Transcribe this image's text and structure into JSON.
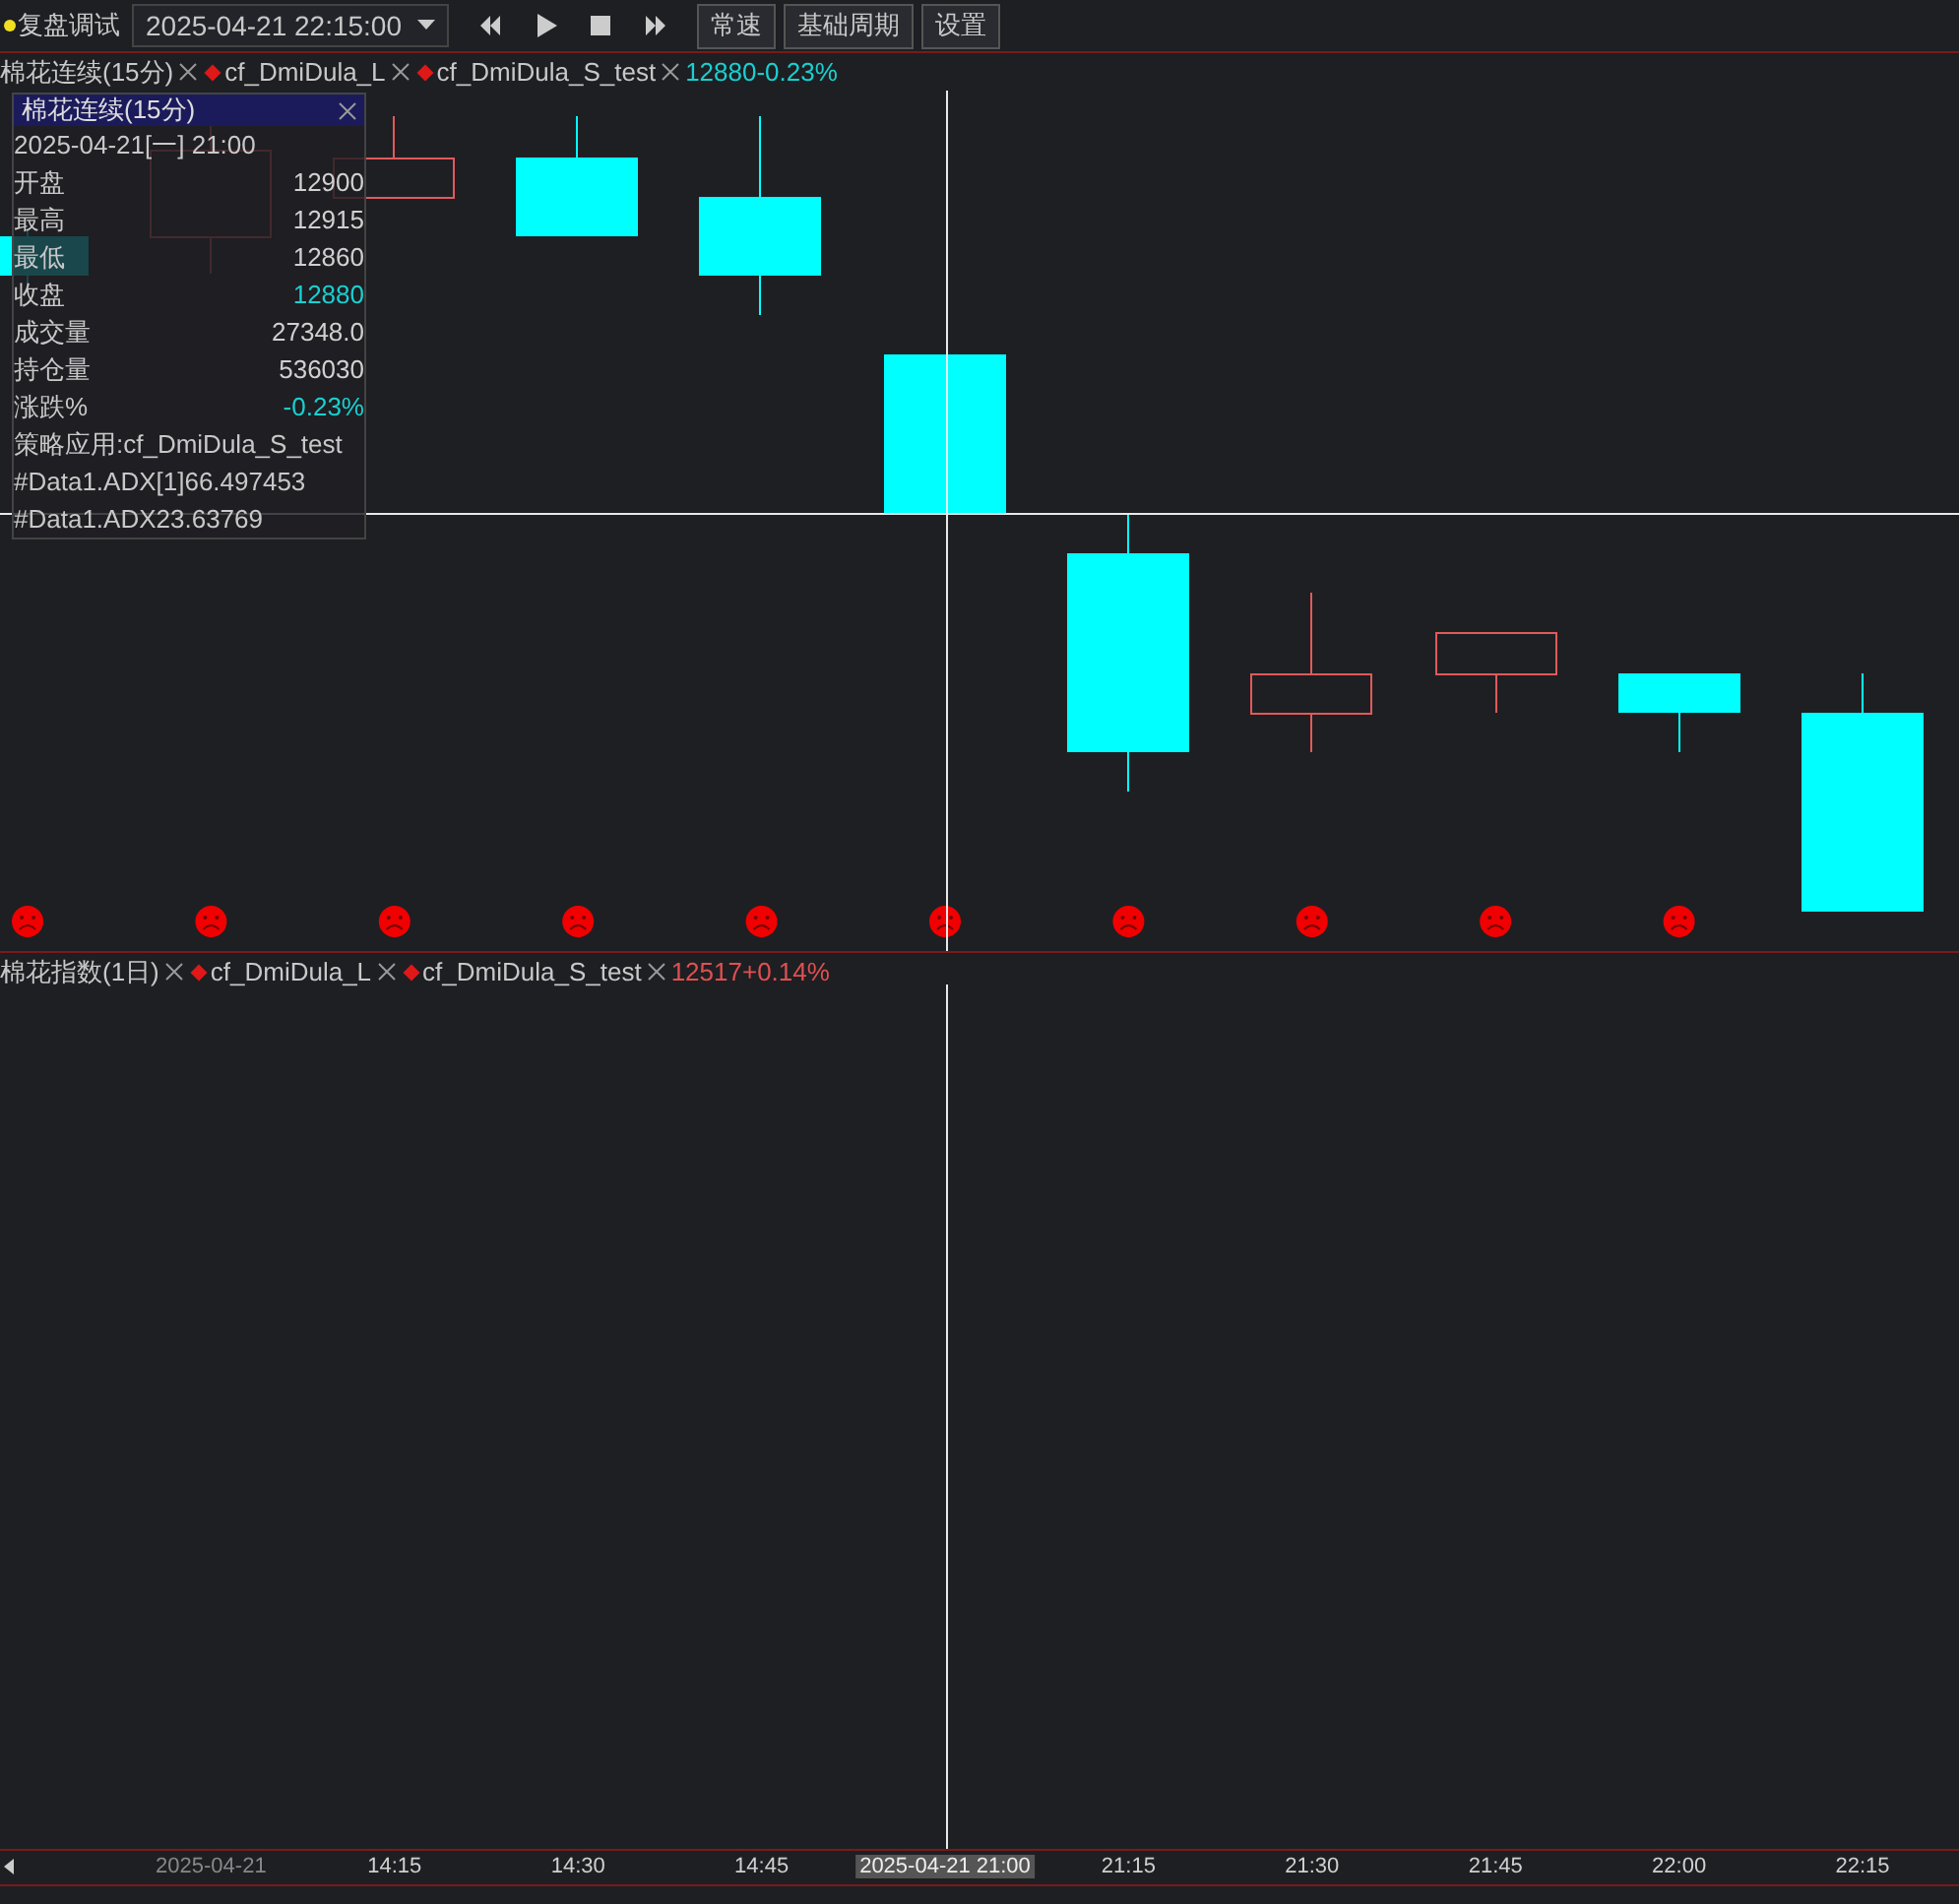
{
  "toolbar": {
    "title": "复盘调试",
    "datetime": "2025-04-21 22:15:00",
    "buttons": [
      "常速",
      "基础周期",
      "设置"
    ]
  },
  "panes": [
    {
      "symbol": "棉花连续(15分)",
      "strategies": [
        "cf_DmiDula_L",
        "cf_DmiDula_S_test"
      ],
      "quote": "12880-0.23%",
      "color": "#19d0d0"
    },
    {
      "symbol": "棉花指数(1日)",
      "strategies": [
        "cf_DmiDula_L",
        "cf_DmiDula_S_test"
      ],
      "quote": "12517+0.14%",
      "color": "#e05050"
    }
  ],
  "tooltip": {
    "title": "棉花连续(15分)",
    "date": "2025-04-21[一] 21:00",
    "rows": [
      {
        "label": "开盘",
        "value": "12900",
        "color": "#d0d0d0"
      },
      {
        "label": "最高",
        "value": "12915",
        "color": "#d0d0d0"
      },
      {
        "label": "最低",
        "value": "12860",
        "color": "#d0d0d0"
      },
      {
        "label": "收盘",
        "value": "12880",
        "color": "#19d0d0"
      },
      {
        "label": "成交量",
        "value": "27348.0",
        "color": "#d0d0d0"
      },
      {
        "label": "持仓量",
        "value": "536030",
        "color": "#d0d0d0"
      },
      {
        "label": "涨跌%",
        "value": "-0.23%",
        "color": "#19d0d0"
      }
    ],
    "lines": [
      "策略应用:cf_DmiDula_S_test",
      "#Data1.ADX[1]66.497453",
      "#Data1.ADX23.63769"
    ]
  },
  "time_axis": [
    {
      "label": "2025-04-21",
      "kind": "date"
    },
    {
      "label": "14:15",
      "kind": "time"
    },
    {
      "label": "14:30",
      "kind": "time"
    },
    {
      "label": "14:45",
      "kind": "time"
    },
    {
      "label": "2025-04-21 21:00",
      "kind": "cursor"
    },
    {
      "label": "21:15",
      "kind": "time"
    },
    {
      "label": "21:30",
      "kind": "time"
    },
    {
      "label": "21:45",
      "kind": "time"
    },
    {
      "label": "22:00",
      "kind": "time"
    },
    {
      "label": "22:15",
      "kind": "time"
    }
  ]
}
